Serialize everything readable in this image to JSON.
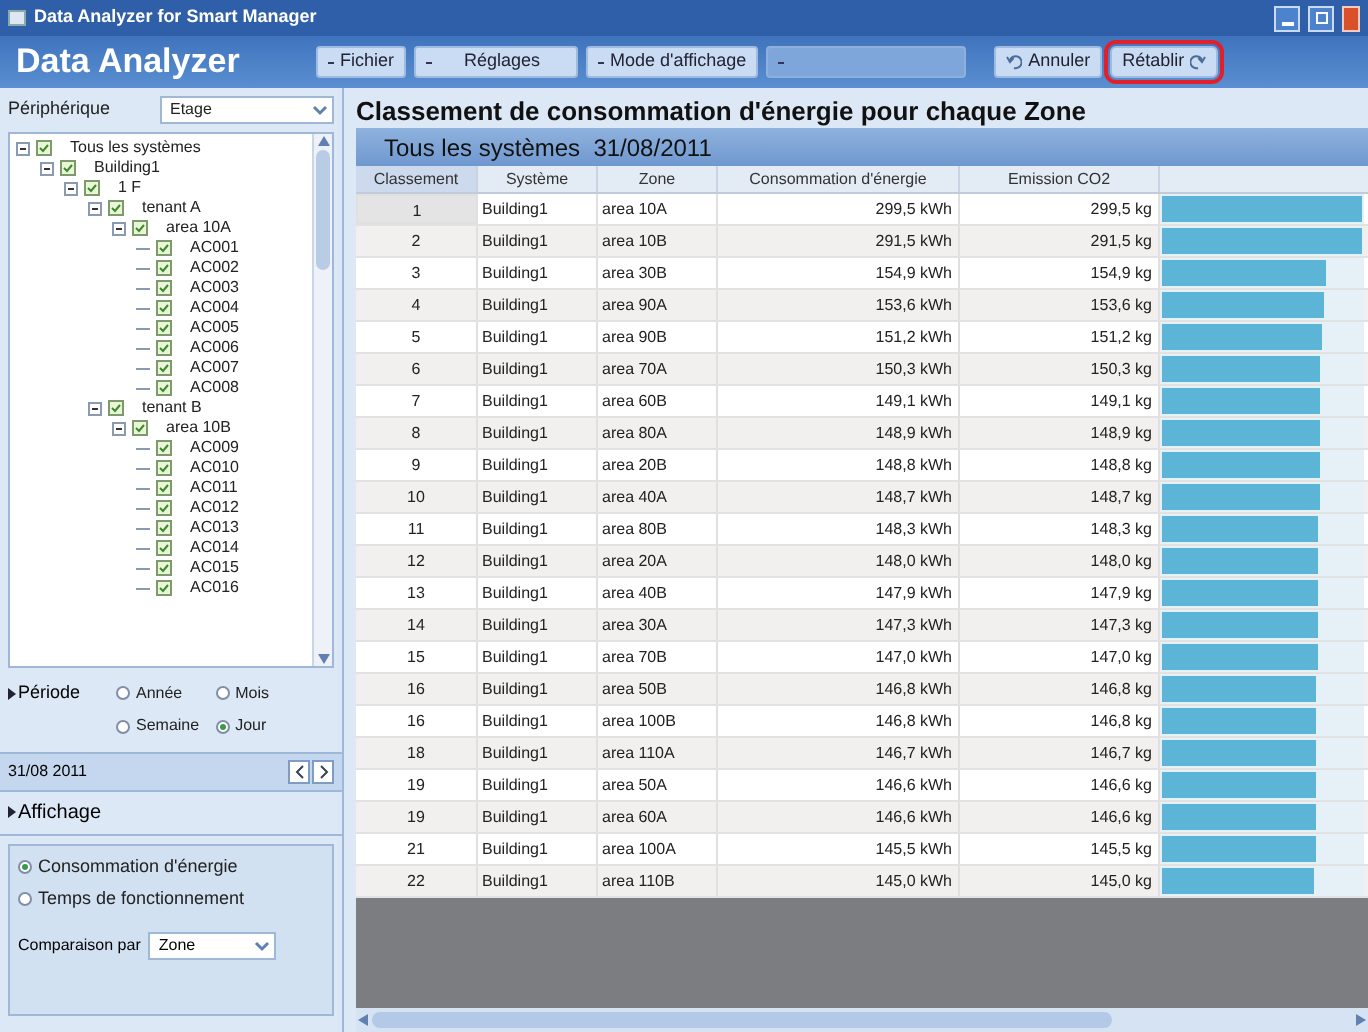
{
  "window": {
    "title": "Data Analyzer for Smart Manager"
  },
  "app_title": "Data Analyzer",
  "toolbar": [
    {
      "kind": "menu",
      "label": "Fichier",
      "disabled": false,
      "highlighted": false
    },
    {
      "kind": "menu",
      "label": "Réglages",
      "disabled": false,
      "highlighted": false
    },
    {
      "kind": "menu",
      "label": "Mode d'affichage",
      "disabled": false,
      "highlighted": false
    },
    {
      "kind": "menu",
      "disabled": true,
      "highlighted": false
    },
    {
      "kind": "undo",
      "label": "Annuler",
      "disabled": false,
      "highlighted": false
    },
    {
      "kind": "redo",
      "label": "Rétablir",
      "disabled": false,
      "highlighted": true
    }
  ],
  "sidebar": {
    "device_label": "Périphérique",
    "device_value": "Etage",
    "tree": [
      {
        "label": "Tous les systèmes",
        "checked": true,
        "expanded": true,
        "children": [
          {
            "label": "Building1",
            "checked": true,
            "expanded": true,
            "children": [
              {
                "label": "1 F",
                "checked": true,
                "expanded": true,
                "children": [
                  {
                    "label": "tenant A",
                    "checked": true,
                    "expanded": true,
                    "children": [
                      {
                        "label": "area 10A",
                        "checked": true,
                        "expanded": true,
                        "children": [
                          {
                            "label": "AC001",
                            "checked": true
                          },
                          {
                            "label": "AC002",
                            "checked": true
                          },
                          {
                            "label": "AC003",
                            "checked": true
                          },
                          {
                            "label": "AC004",
                            "checked": true
                          },
                          {
                            "label": "AC005",
                            "checked": true
                          },
                          {
                            "label": "AC006",
                            "checked": true
                          },
                          {
                            "label": "AC007",
                            "checked": true
                          },
                          {
                            "label": "AC008",
                            "checked": true
                          }
                        ]
                      }
                    ]
                  },
                  {
                    "label": "tenant B",
                    "checked": true,
                    "expanded": true,
                    "children": [
                      {
                        "label": "area 10B",
                        "checked": true,
                        "expanded": true,
                        "children": [
                          {
                            "label": "AC009",
                            "checked": true
                          },
                          {
                            "label": "AC010",
                            "checked": true
                          },
                          {
                            "label": "AC011",
                            "checked": true
                          },
                          {
                            "label": "AC012",
                            "checked": true
                          },
                          {
                            "label": "AC013",
                            "checked": true
                          },
                          {
                            "label": "AC014",
                            "checked": true
                          },
                          {
                            "label": "AC015",
                            "checked": true
                          },
                          {
                            "label": "AC016",
                            "checked": true
                          }
                        ]
                      }
                    ]
                  }
                ]
              }
            ]
          }
        ]
      }
    ],
    "period": {
      "label": "Période",
      "options": [
        {
          "label": "Année",
          "selected": false
        },
        {
          "label": "Mois",
          "selected": false
        },
        {
          "label": "Semaine",
          "selected": false
        },
        {
          "label": "Jour",
          "selected": true
        }
      ]
    },
    "date": "31/08 2011",
    "display": {
      "label": "Affichage",
      "options": [
        {
          "label": "Consommation d'énergie",
          "selected": true
        },
        {
          "label": "Temps de fonctionnement",
          "selected": false
        }
      ],
      "compare_label": "Comparaison par",
      "compare_value": "Zone"
    }
  },
  "main": {
    "title": "Classement de consommation d'énergie pour chaque Zone",
    "subtitle": "Tous les systèmes  31/08/2011",
    "columns": [
      "Classement",
      "Système",
      "Zone",
      "Consommation d'énergie",
      "Emission CO2"
    ],
    "rows": [
      {
        "rank": "1",
        "system": "Building1",
        "zone": "area 10A",
        "energy": "299,5 kWh",
        "co2": "299,5 kg",
        "level": 1,
        "selected": true
      },
      {
        "rank": "2",
        "system": "Building1",
        "zone": "area 10B",
        "energy": "291,5 kWh",
        "co2": "291,5 kg",
        "level": 1,
        "selected": false
      },
      {
        "rank": "3",
        "system": "Building1",
        "zone": "area 30B",
        "energy": "154,9 kWh",
        "co2": "154,9 kg",
        "level": 0.82,
        "selected": false
      },
      {
        "rank": "4",
        "system": "Building1",
        "zone": "area 90A",
        "energy": "153,6 kWh",
        "co2": "153,6 kg",
        "level": 0.81,
        "selected": false
      },
      {
        "rank": "5",
        "system": "Building1",
        "zone": "area 90B",
        "energy": "151,2 kWh",
        "co2": "151,2 kg",
        "level": 0.8,
        "selected": false
      },
      {
        "rank": "6",
        "system": "Building1",
        "zone": "area 70A",
        "energy": "150,3 kWh",
        "co2": "150,3 kg",
        "level": 0.79,
        "selected": false
      },
      {
        "rank": "7",
        "system": "Building1",
        "zone": "area 60B",
        "energy": "149,1 kWh",
        "co2": "149,1 kg",
        "level": 0.79,
        "selected": false
      },
      {
        "rank": "8",
        "system": "Building1",
        "zone": "area 80A",
        "energy": "148,9 kWh",
        "co2": "148,9 kg",
        "level": 0.79,
        "selected": false
      },
      {
        "rank": "9",
        "system": "Building1",
        "zone": "area 20B",
        "energy": "148,8 kWh",
        "co2": "148,8 kg",
        "level": 0.79,
        "selected": false
      },
      {
        "rank": "10",
        "system": "Building1",
        "zone": "area 40A",
        "energy": "148,7 kWh",
        "co2": "148,7 kg",
        "level": 0.79,
        "selected": false
      },
      {
        "rank": "11",
        "system": "Building1",
        "zone": "area 80B",
        "energy": "148,3 kWh",
        "co2": "148,3 kg",
        "level": 0.78,
        "selected": false
      },
      {
        "rank": "12",
        "system": "Building1",
        "zone": "area 20A",
        "energy": "148,0 kWh",
        "co2": "148,0 kg",
        "level": 0.78,
        "selected": false
      },
      {
        "rank": "13",
        "system": "Building1",
        "zone": "area 40B",
        "energy": "147,9 kWh",
        "co2": "147,9 kg",
        "level": 0.78,
        "selected": false
      },
      {
        "rank": "14",
        "system": "Building1",
        "zone": "area 30A",
        "energy": "147,3 kWh",
        "co2": "147,3 kg",
        "level": 0.78,
        "selected": false
      },
      {
        "rank": "15",
        "system": "Building1",
        "zone": "area 70B",
        "energy": "147,0 kWh",
        "co2": "147,0 kg",
        "level": 0.78,
        "selected": false
      },
      {
        "rank": "16",
        "system": "Building1",
        "zone": "area 50B",
        "energy": "146,8 kWh",
        "co2": "146,8 kg",
        "level": 0.77,
        "selected": false
      },
      {
        "rank": "16",
        "system": "Building1",
        "zone": "area 100B",
        "energy": "146,8 kWh",
        "co2": "146,8 kg",
        "level": 0.77,
        "selected": false
      },
      {
        "rank": "18",
        "system": "Building1",
        "zone": "area 110A",
        "energy": "146,7 kWh",
        "co2": "146,7 kg",
        "level": 0.77,
        "selected": false
      },
      {
        "rank": "19",
        "system": "Building1",
        "zone": "area 50A",
        "energy": "146,6 kWh",
        "co2": "146,6 kg",
        "level": 0.77,
        "selected": false
      },
      {
        "rank": "19",
        "system": "Building1",
        "zone": "area 60A",
        "energy": "146,6 kWh",
        "co2": "146,6 kg",
        "level": 0.77,
        "selected": false
      },
      {
        "rank": "21",
        "system": "Building1",
        "zone": "area 100A",
        "energy": "145,5 kWh",
        "co2": "145,5 kg",
        "level": 0.77,
        "selected": false
      },
      {
        "rank": "22",
        "system": "Building1",
        "zone": "area 110B",
        "energy": "145,0 kWh",
        "co2": "145,0 kg",
        "level": 0.76,
        "selected": false
      }
    ]
  }
}
